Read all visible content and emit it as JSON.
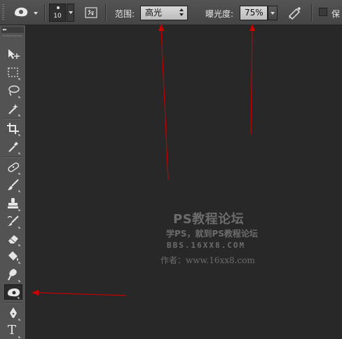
{
  "options_bar": {
    "tool_preset_icon": "dodge-tool-icon",
    "brush_size": "10",
    "brush_panel_icon": "brush-panel-icon",
    "range_label": "范围:",
    "range_value": "高光",
    "exposure_label": "曝光度:",
    "exposure_value": "75%",
    "airbrush_icon": "airbrush-icon",
    "protect_tones_label": "保"
  },
  "toolbar": {
    "collapse_label": "▸▸",
    "tools": [
      {
        "name": "move-tool",
        "icon": "move-icon"
      },
      {
        "name": "marquee-tool",
        "icon": "rect-marquee-icon"
      },
      {
        "name": "lasso-tool",
        "icon": "lasso-icon"
      },
      {
        "name": "magic-wand-tool",
        "icon": "magic-wand-icon"
      },
      {
        "name": "crop-tool",
        "icon": "crop-icon"
      },
      {
        "name": "eyedropper-tool",
        "icon": "eyedropper-icon"
      },
      {
        "name": "healing-brush-tool",
        "icon": "bandage-icon"
      },
      {
        "name": "brush-tool",
        "icon": "brush-icon"
      },
      {
        "name": "clone-stamp-tool",
        "icon": "stamp-icon"
      },
      {
        "name": "history-brush-tool",
        "icon": "history-brush-icon"
      },
      {
        "name": "eraser-tool",
        "icon": "eraser-icon"
      },
      {
        "name": "paint-bucket-tool",
        "icon": "paint-bucket-icon"
      },
      {
        "name": "blur-tool",
        "icon": "blur-icon"
      },
      {
        "name": "dodge-tool",
        "icon": "dodge-icon",
        "active": true
      },
      {
        "name": "pen-tool",
        "icon": "pen-icon"
      },
      {
        "name": "type-tool",
        "icon": "type-icon",
        "glyph": "T"
      }
    ]
  },
  "watermark": {
    "title": "PS教程论坛",
    "subtitle": "学PS，就到PS教程论坛",
    "bbs": "BBS.16XX8.COM",
    "author": "作者：www.16xx8.com"
  },
  "colors": {
    "annotation_arrow": "#d00000",
    "canvas_bg": "#282828",
    "panel_bg": "#535353"
  }
}
